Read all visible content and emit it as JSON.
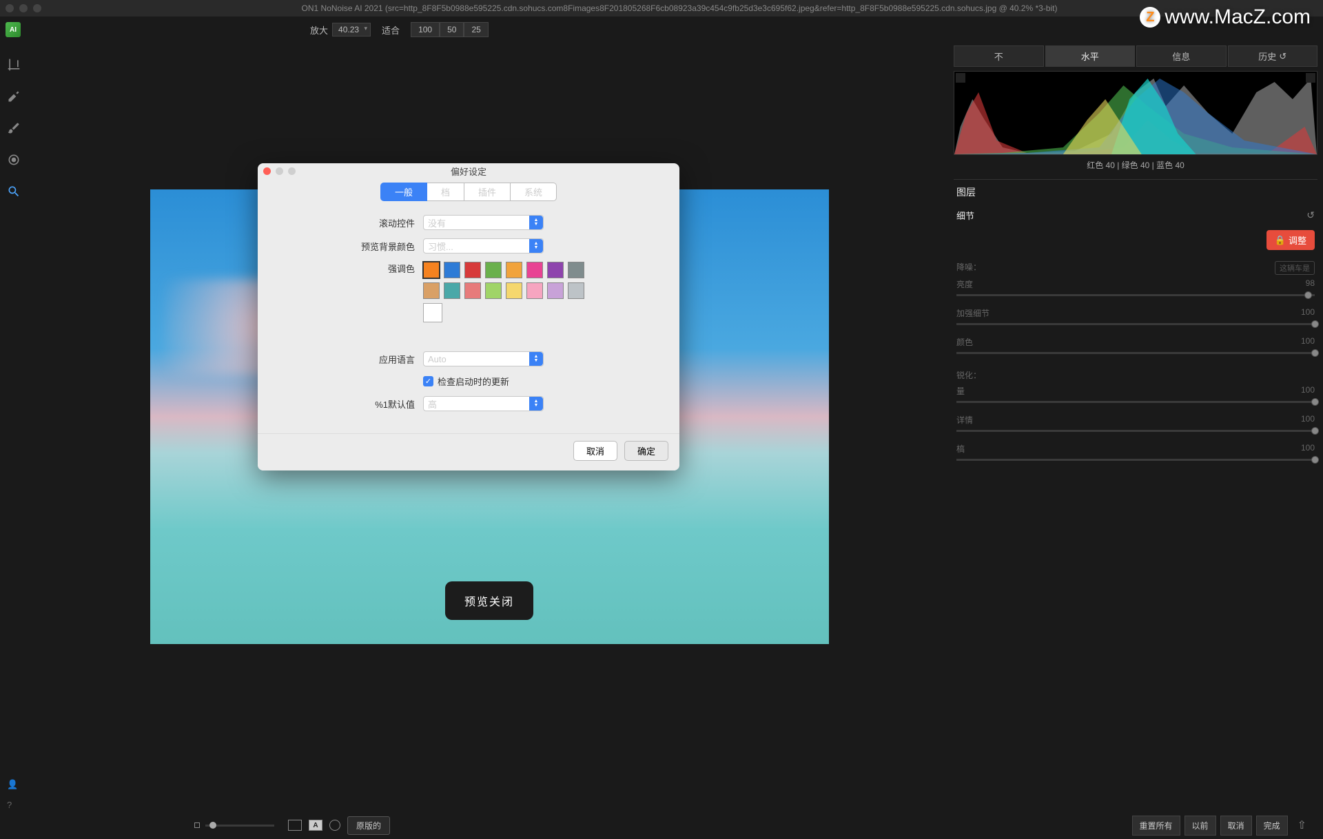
{
  "titlebar": {
    "text": "ON1 NoNoise AI 2021 (src=http_8F8F5b0988e595225.cdn.sohucs.com8Fimages8F201805268F6cb08923a39c454c9fb25d3e3c695f62.jpeg&refer=http_8F8F5b0988e595225.cdn.sohucs.jpg @ 40.2% *3-bit)"
  },
  "watermark": "www.MacZ.com",
  "toprow": {
    "zoom_label": "放大",
    "zoom_value": "40.23",
    "fit_label": "适合",
    "zoom_presets": [
      "100",
      "50",
      "25"
    ]
  },
  "left_tools": [
    "crop",
    "retouch",
    "brush",
    "eye",
    "hand-zoom"
  ],
  "preview_toast": "预览关闭",
  "right_panel": {
    "tabs": [
      "不",
      "水平",
      "信息",
      "历史"
    ],
    "active_tab": 1,
    "hist_readout": "红色  40  | 绿色  40  | 蓝色  40",
    "layers_label": "图层",
    "detail_label": "细节",
    "adjust_label": "调整",
    "noise_section": {
      "title": "降噪：",
      "extra": "这辆车是",
      "sliders": [
        {
          "label": "亮度",
          "value": 98,
          "pos": 98
        },
        {
          "label": "加强细节",
          "value": 100,
          "pos": 100
        },
        {
          "label": "颜色",
          "value": 100,
          "pos": 100
        }
      ]
    },
    "sharpen_section": {
      "title": "锐化：",
      "sliders": [
        {
          "label": "量",
          "value": 100,
          "pos": 100
        },
        {
          "label": "详情",
          "value": 100,
          "pos": 100
        },
        {
          "label": "槁",
          "value": 100,
          "pos": 100
        }
      ]
    }
  },
  "dialog": {
    "title": "偏好设定",
    "tabs": [
      "一般",
      "档",
      "插件",
      "系统"
    ],
    "active_tab": 0,
    "scroll_label": "滚动控件",
    "scroll_value": "没有",
    "bgcolor_label": "预览背景颜色",
    "bgcolor_value": "习惯...",
    "accent_label": "强调色",
    "accent_colors_row1": [
      "#f58220",
      "#2e7bd6",
      "#d73a3a",
      "#6ab04c",
      "#f1a33c",
      "#e84393",
      "#8e44ad",
      "#7f8c8d"
    ],
    "accent_colors_row2": [
      "#d9a066",
      "#4aa8a8",
      "#e77b7b",
      "#a0d468",
      "#f5d76e",
      "#f6a5c0",
      "#c8a2d8",
      "#bdc3c7"
    ],
    "lang_label": "应用语言",
    "lang_value": "Auto",
    "checkupdate_label": "检查启动时的更新",
    "default_label": "%1默认值",
    "default_value": "高",
    "cancel": "取消",
    "ok": "确定"
  },
  "bottombar": {
    "original_label": "原版的",
    "reset_all": "重置所有",
    "before": "以前",
    "cancel": "取消",
    "done": "完成"
  }
}
